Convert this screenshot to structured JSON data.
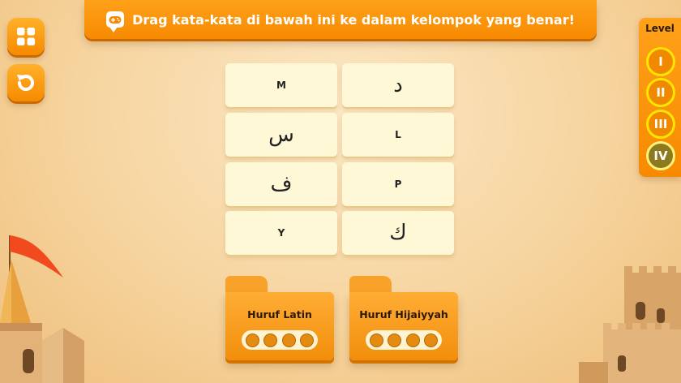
{
  "banner": {
    "text": "Drag kata-kata di bawah ini ke dalam kelompok yang benar!",
    "icon": "chat-gamepad-icon"
  },
  "side_buttons": [
    {
      "name": "menu-grid",
      "icon": "grid-icon"
    },
    {
      "name": "restart",
      "icon": "refresh-icon"
    }
  ],
  "level": {
    "title": "Level",
    "items": [
      {
        "label": "I",
        "active": false
      },
      {
        "label": "II",
        "active": false
      },
      {
        "label": "III",
        "active": false
      },
      {
        "label": "IV",
        "active": true
      }
    ]
  },
  "cards": [
    {
      "text": "M",
      "arabic": false
    },
    {
      "text": "د",
      "arabic": true
    },
    {
      "text": "س",
      "arabic": true
    },
    {
      "text": "L",
      "arabic": false
    },
    {
      "text": "ف",
      "arabic": true
    },
    {
      "text": "P",
      "arabic": false
    },
    {
      "text": "Y",
      "arabic": false
    },
    {
      "text": "ك",
      "arabic": true
    }
  ],
  "folders": [
    {
      "label": "Huruf Latin",
      "slots": 4
    },
    {
      "label": "Huruf Hijaiyyah",
      "slots": 4
    }
  ],
  "colors": {
    "accent": "#f78a00",
    "card": "#fff8d6",
    "level_ring": "#ffe600"
  }
}
